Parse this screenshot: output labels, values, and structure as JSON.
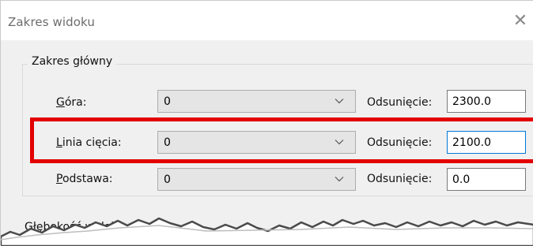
{
  "dialog": {
    "title": "Zakres widoku",
    "close_glyph": "✕"
  },
  "primary_range": {
    "group_title": "Zakres główny",
    "rows": [
      {
        "label_u": "G",
        "label_rest": "óra:",
        "level": "0",
        "offset_label_u": "O",
        "offset_label_rest": "dsunięcie:",
        "offset_value": "2300.0"
      },
      {
        "label_u": "L",
        "label_rest": "inia cięcia:",
        "level": "0",
        "offset_label_pre": "O",
        "offset_label_u": "d",
        "offset_label_rest": "sunięcie:",
        "offset_value": "2100.0"
      },
      {
        "label_u": "P",
        "label_rest": "odstawa:",
        "level": "0",
        "offset_label_pre": "O",
        "offset_label_u": "d",
        "offset_label_rest": "sunięcie:",
        "offset_value": "0.0"
      }
    ]
  },
  "view_depth": {
    "group_title_partial": "Głębokość widoku"
  },
  "colors": {
    "highlight": "#e30000",
    "focus_border": "#0078d7",
    "dialog_bg": "#f0f0f0"
  },
  "icons": {
    "combo_arrow": "chevron-down-icon",
    "close": "close-icon"
  }
}
